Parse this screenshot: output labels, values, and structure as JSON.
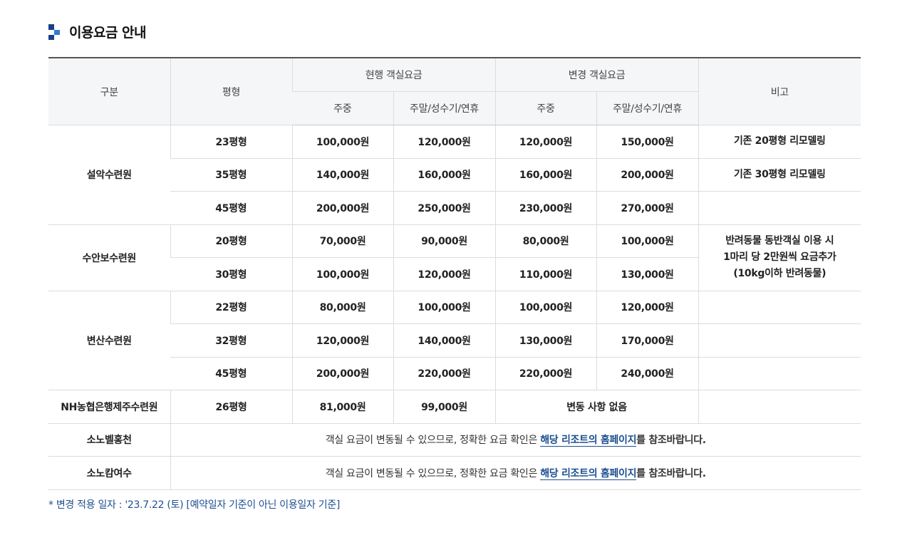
{
  "section": {
    "title": "이용요금 안내"
  },
  "table": {
    "headers": {
      "category": "구분",
      "size": "평형",
      "current": "현행 객실요금",
      "changed": "변경 객실요금",
      "note": "비고",
      "weekday": "주중",
      "weekend": "주말/성수기/연휴"
    },
    "resorts": [
      {
        "name": "설악수련원",
        "rows": [
          {
            "size": "23평형",
            "cur_weekday": "100,000원",
            "cur_weekend": "120,000원",
            "new_weekday": "120,000원",
            "new_weekend": "150,000원",
            "note": "기존 20평형 리모델링"
          },
          {
            "size": "35평형",
            "cur_weekday": "140,000원",
            "cur_weekend": "160,000원",
            "new_weekday": "160,000원",
            "new_weekend": "200,000원",
            "note": "기존 30평형 리모델링"
          },
          {
            "size": "45평형",
            "cur_weekday": "200,000원",
            "cur_weekend": "250,000원",
            "new_weekday": "230,000원",
            "new_weekend": "270,000원",
            "note": ""
          }
        ]
      },
      {
        "name": "수안보수련원",
        "note_lines": [
          "반려동물 동반객실 이용 시",
          "1마리 당 2만원씩 요금추가",
          "(10kg이하 반려동물)"
        ],
        "rows": [
          {
            "size": "20평형",
            "cur_weekday": "70,000원",
            "cur_weekend": "90,000원",
            "new_weekday": "80,000원",
            "new_weekend": "100,000원"
          },
          {
            "size": "30평형",
            "cur_weekday": "100,000원",
            "cur_weekend": "120,000원",
            "new_weekday": "110,000원",
            "new_weekend": "130,000원"
          }
        ]
      },
      {
        "name": "변산수련원",
        "rows": [
          {
            "size": "22평형",
            "cur_weekday": "80,000원",
            "cur_weekend": "100,000원",
            "new_weekday": "100,000원",
            "new_weekend": "120,000원",
            "note": ""
          },
          {
            "size": "32평형",
            "cur_weekday": "120,000원",
            "cur_weekend": "140,000원",
            "new_weekday": "130,000원",
            "new_weekend": "170,000원",
            "note": ""
          },
          {
            "size": "45평형",
            "cur_weekday": "200,000원",
            "cur_weekend": "220,000원",
            "new_weekday": "220,000원",
            "new_weekend": "240,000원",
            "note": ""
          }
        ]
      },
      {
        "name": "NH농협은행제주수련원",
        "rows": [
          {
            "size": "26평형",
            "cur_weekday": "81,000원",
            "cur_weekend": "99,000원",
            "new_combined": "변동 사항 없음",
            "note": ""
          }
        ]
      }
    ],
    "notice_rows": [
      {
        "name": "소노벨홍천",
        "text_before": "객실 요금이 변동될 수 있으므로, 정확한 요금 확인은 ",
        "link": "해당 리조트의 홈페이지",
        "text_after": "를 참조바랍니다."
      },
      {
        "name": "소노캄여수",
        "text_before": "객실 요금이 변동될 수 있으므로, 정확한 요금 확인은 ",
        "link": "해당 리조트의 홈페이지",
        "text_after": "를 참조바랍니다."
      }
    ]
  },
  "footnote": "* 변경 적용 일자 : '23.7.22 (토) [예약일자 기준이 아닌 이용일자 기준]",
  "colors": {
    "accent_dark": "#1b3f86",
    "accent_light": "#2f7dd1",
    "link": "#1d4f91",
    "header_bg": "#f5f6f7"
  }
}
